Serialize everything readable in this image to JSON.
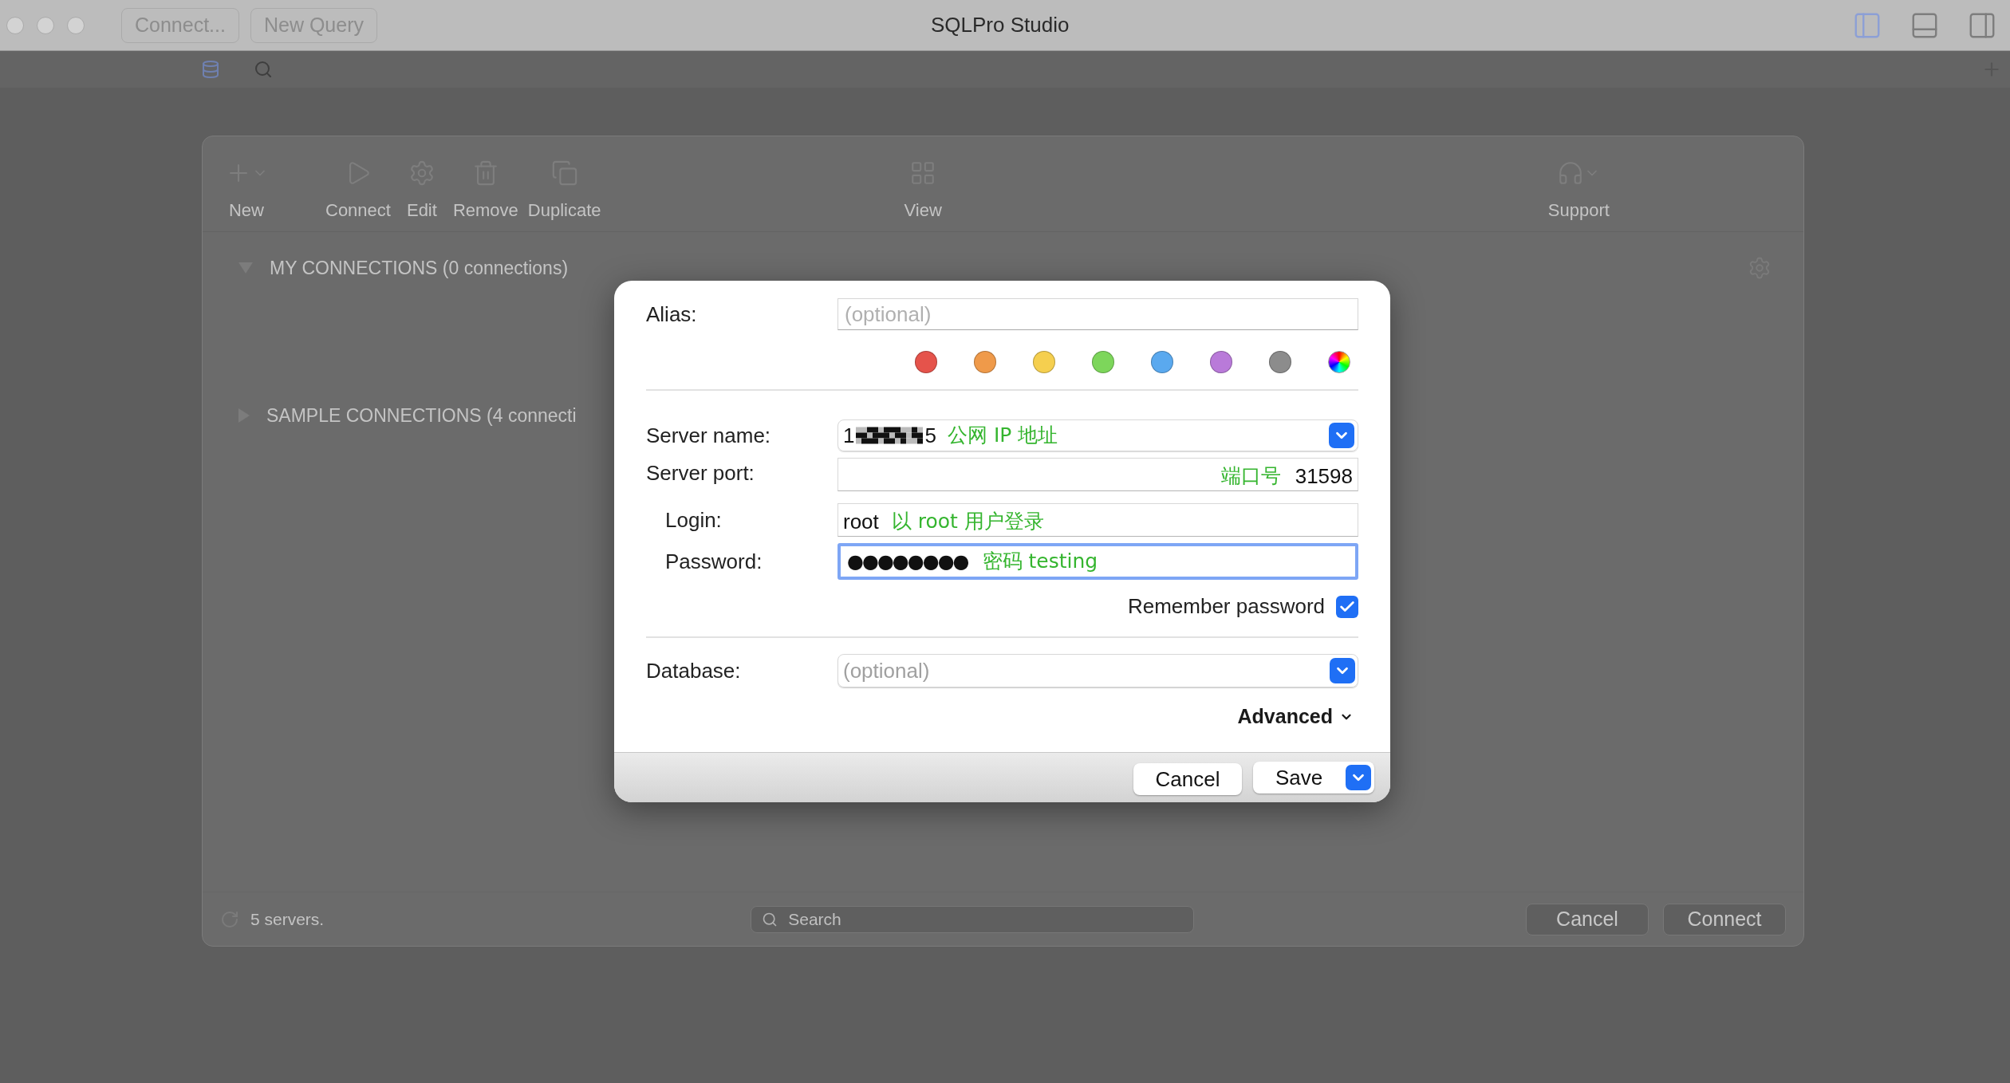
{
  "window": {
    "title": "SQLPro Studio",
    "tab_buttons": [
      "Connect...",
      "New Query"
    ]
  },
  "toolbar": [
    {
      "label": "New",
      "kind": "new"
    },
    {
      "label": "Connect",
      "kind": "connect"
    },
    {
      "label": "Edit",
      "kind": "edit"
    },
    {
      "label": "Remove",
      "kind": "remove"
    },
    {
      "label": "Duplicate",
      "kind": "duplicate"
    },
    {
      "label": "View",
      "kind": "view"
    },
    {
      "label": "Support",
      "kind": "support"
    }
  ],
  "groups": [
    {
      "title": "MY CONNECTIONS (0 connections)",
      "expanded": true
    },
    {
      "title": "SAMPLE CONNECTIONS (4 connecti",
      "expanded": false
    }
  ],
  "status_bar": {
    "count": "5 servers.",
    "search_placeholder": "Search",
    "buttons": [
      "Cancel",
      "Connect"
    ]
  },
  "dialog": {
    "alias": {
      "label": "Alias:",
      "placeholder": "(optional)"
    },
    "colors": [
      {
        "kind": "swatch",
        "color": "#e5534b"
      },
      {
        "kind": "swatch",
        "color": "#ef9a4a"
      },
      {
        "kind": "swatch",
        "color": "#f5cf4f"
      },
      {
        "kind": "swatch",
        "color": "#7dd65b"
      },
      {
        "kind": "swatch",
        "color": "#5aa9ef"
      },
      {
        "kind": "swatch",
        "color": "#b97ad9"
      },
      {
        "kind": "swatch",
        "color": "#8c8c8c"
      },
      {
        "kind": "spectrum"
      }
    ],
    "server_name": {
      "label": "Server name:",
      "value_start": "1",
      "value_end": "5",
      "note": "公网 IP 地址"
    },
    "server_port": {
      "label": "Server port:",
      "note": "端口号",
      "value": "31598"
    },
    "login": {
      "label": "Login:",
      "value": "root",
      "note": "以 root 用户登录"
    },
    "password": {
      "label": "Password:",
      "value": "●●●●●●●●",
      "note": "密码 testing",
      "focused": true
    },
    "remember": {
      "label": "Remember password",
      "checked": true
    },
    "database": {
      "label": "Database:",
      "placeholder": "(optional)"
    },
    "advanced": {
      "label": "Advanced",
      "expanded": false
    },
    "buttons": [
      {
        "label": "Cancel",
        "kind": "plain"
      },
      {
        "label": "Save",
        "kind": "split"
      }
    ]
  }
}
